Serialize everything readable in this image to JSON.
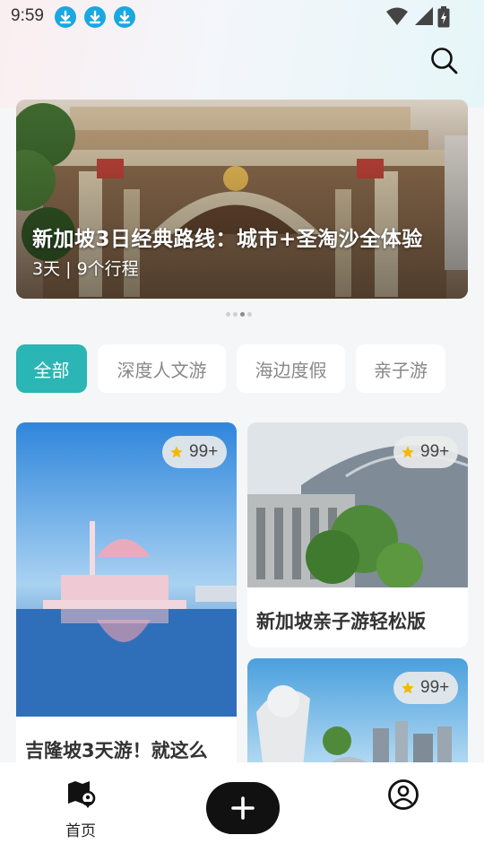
{
  "status_bar": {
    "time": "9:59",
    "icons": [
      "download-icon",
      "download-icon",
      "download-icon",
      "wifi-icon",
      "signal-icon",
      "battery-icon"
    ]
  },
  "header": {
    "search_icon": "search-icon"
  },
  "banner": {
    "title": "新加坡3日经典路线：城市+圣淘沙全体验",
    "subtitle": "3天 | 9个行程",
    "page_count": 4,
    "active_page": 3
  },
  "tabs": [
    {
      "label": "全部",
      "active": true
    },
    {
      "label": "深度人文游",
      "active": false
    },
    {
      "label": "海边度假",
      "active": false
    },
    {
      "label": "亲子游",
      "active": false
    }
  ],
  "cards": [
    {
      "title": "吉隆坡3天游！就这么",
      "badge": "99+"
    },
    {
      "title": "新加坡亲子游轻松版",
      "badge": "99+"
    },
    {
      "title": "",
      "badge": "99+"
    }
  ],
  "bottom_nav": {
    "home_label": "首页",
    "home_icon": "map-pin-icon",
    "add_icon": "plus-icon",
    "profile_icon": "user-circle-icon"
  },
  "colors": {
    "accent": "#2bb5b5",
    "download_badge": "#19a8e0",
    "star": "#f5b800"
  }
}
